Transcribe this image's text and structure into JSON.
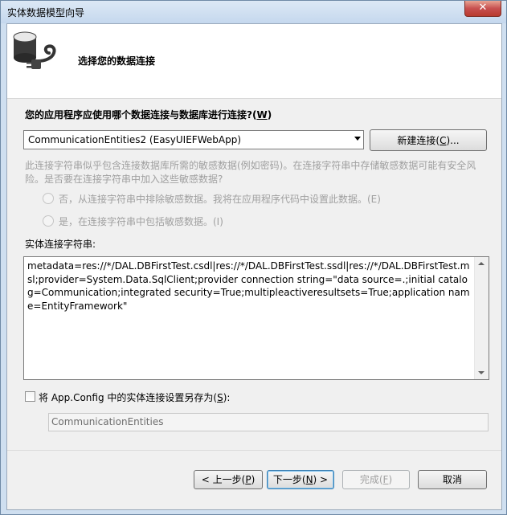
{
  "window": {
    "title": "实体数据模型向导",
    "close_symbol": "✕"
  },
  "header": {
    "title": "选择您的数据连接",
    "icon": "database-plug-icon"
  },
  "question": {
    "text": "您的应用程序应使用哪个数据连接与数据库进行连接?(",
    "mnemonic": "W",
    "suffix": ")"
  },
  "connection_select": {
    "value": "CommunicationEntities2 (EasyUIEFWebApp)"
  },
  "new_connection_button": {
    "label": "新建连接(",
    "mnemonic": "C",
    "suffix": ")..."
  },
  "sensitive_info": {
    "description": "此连接字符串似乎包含连接数据库所需的敏感数据(例如密码)。在连接字符串中存储敏感数据可能有安全风险。是否要在连接字符串中加入这些敏感数据?",
    "option_no": "否，从连接字符串中排除敏感数据。我将在应用程序代码中设置此数据。(E)",
    "option_yes": "是，在连接字符串中包括敏感数据。(I)"
  },
  "entity_connection": {
    "label": "实体连接字符串:",
    "value": "metadata=res://*/DAL.DBFirstTest.csdl|res://*/DAL.DBFirstTest.ssdl|res://*/DAL.DBFirstTest.msl;provider=System.Data.SqlClient;provider connection string=\"data source=.;initial catalog=Communication;integrated security=True;multipleactiveresultsets=True;application name=EntityFramework\""
  },
  "save_setting": {
    "checked": false,
    "label": "将 App.Config 中的实体连接设置另存为(",
    "mnemonic": "S",
    "suffix": "):",
    "name_value": "CommunicationEntities"
  },
  "footer": {
    "back": {
      "label": "< 上一步(",
      "mnemonic": "P",
      "suffix": ")"
    },
    "next": {
      "label": "下一步(",
      "mnemonic": "N",
      "suffix": ") >"
    },
    "finish": {
      "label": "完成(",
      "mnemonic": "F",
      "suffix": ")"
    },
    "cancel": {
      "label": "取消"
    }
  }
}
